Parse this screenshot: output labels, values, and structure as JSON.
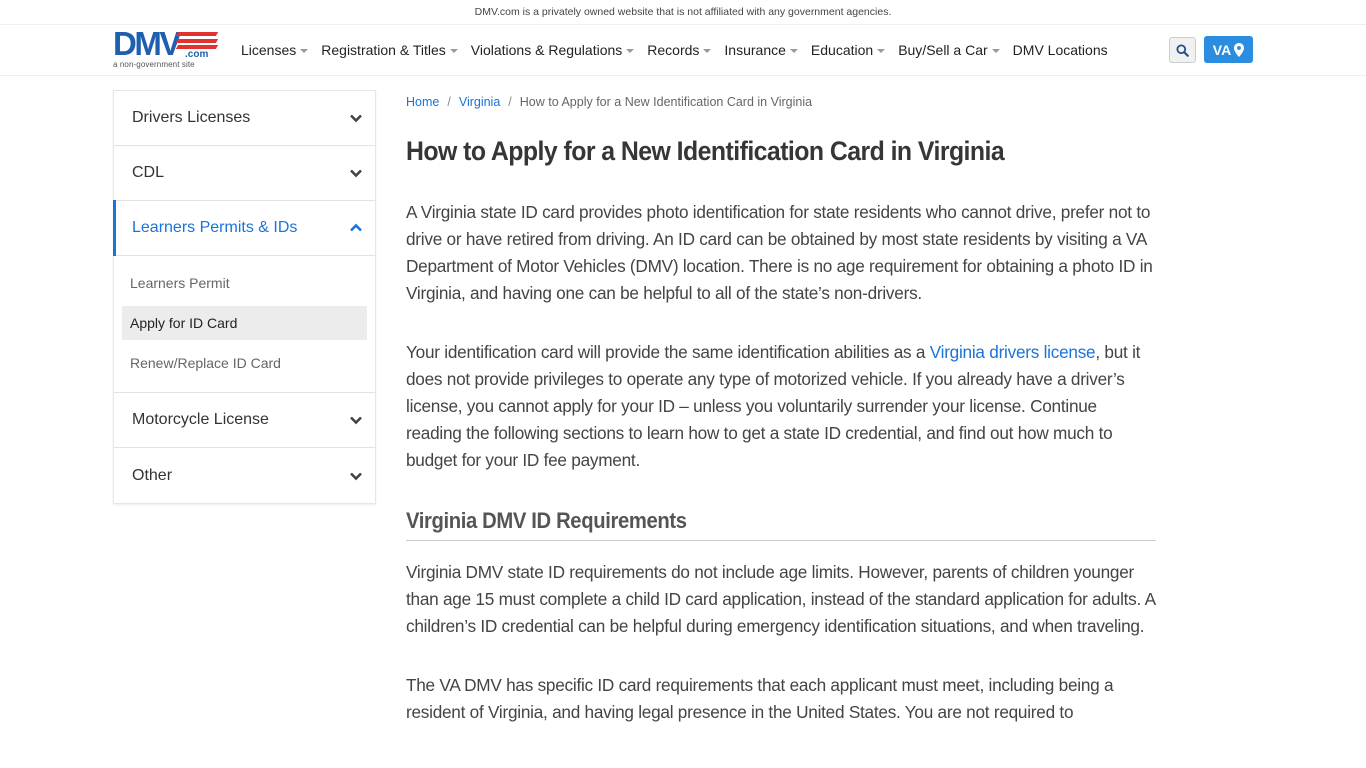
{
  "disclaimer": "DMV.com is a privately owned website that is not affiliated with any government agencies.",
  "logo": {
    "main": "DMV",
    "suffix": ".com",
    "tagline": "a non-government site"
  },
  "nav": {
    "items": [
      {
        "label": "Licenses",
        "dropdown": true
      },
      {
        "label": "Registration & Titles",
        "dropdown": true
      },
      {
        "label": "Violations & Regulations",
        "dropdown": true
      },
      {
        "label": "Records",
        "dropdown": true
      },
      {
        "label": "Insurance",
        "dropdown": true
      },
      {
        "label": "Education",
        "dropdown": true
      },
      {
        "label": "Buy/Sell a Car",
        "dropdown": true
      },
      {
        "label": "DMV Locations",
        "dropdown": false
      }
    ],
    "search_icon": "search-icon",
    "state_label": "VA",
    "state_icon": "map-marker-icon"
  },
  "sidebar": {
    "sections": [
      {
        "label": "Drivers Licenses",
        "expanded": false
      },
      {
        "label": "CDL",
        "expanded": false
      },
      {
        "label": "Learners Permits & IDs",
        "expanded": true,
        "items": [
          "Learners Permit",
          "Apply for ID Card",
          "Renew/Replace ID Card"
        ],
        "current": "Apply for ID Card"
      },
      {
        "label": "Motorcycle License",
        "expanded": false
      },
      {
        "label": "Other",
        "expanded": false
      }
    ]
  },
  "breadcrumb": {
    "home": "Home",
    "state": "Virginia",
    "current": "How to Apply for a New Identification Card in Virginia",
    "separator": "/"
  },
  "article": {
    "title": "How to Apply for a New Identification Card in Virginia",
    "intro": "A Virginia state ID card provides photo identification for state residents who cannot drive, prefer not to drive or have retired from driving. An ID card can be obtained by most state residents by visiting a VA Department of Motor Vehicles (DMV) location. There is no age requirement for obtaining a photo ID in Virginia, and having one can be helpful to all of the state’s non-drivers.",
    "p2_before": "Your identification card will provide the same identification abilities as a ",
    "p2_link": "Virginia drivers license",
    "p2_after": ", but it does not provide privileges to operate any type of motorized vehicle. If you already have a driver’s license, you cannot apply for your ID – unless you voluntarily surrender your license. Continue reading the following sections to learn how to get a state ID credential, and find out how much to budget for your ID fee payment.",
    "section1_heading": "Virginia DMV ID Requirements",
    "section1_p1": "Virginia DMV state ID requirements do not include age limits. However, parents of children younger than age 15 must complete a child ID card application, instead of the standard application for adults. A children’s ID credential can be helpful during emergency identification situations, and when traveling.",
    "section1_p2": "The VA DMV has specific ID card requirements that each applicant must meet, including being a resident of Virginia, and having legal presence in the United States. You are not required to"
  },
  "colors": {
    "brand_blue": "#1f5fb0",
    "brand_red": "#e3312f",
    "link": "#1a73d9",
    "state_button": "#2a8de0"
  }
}
